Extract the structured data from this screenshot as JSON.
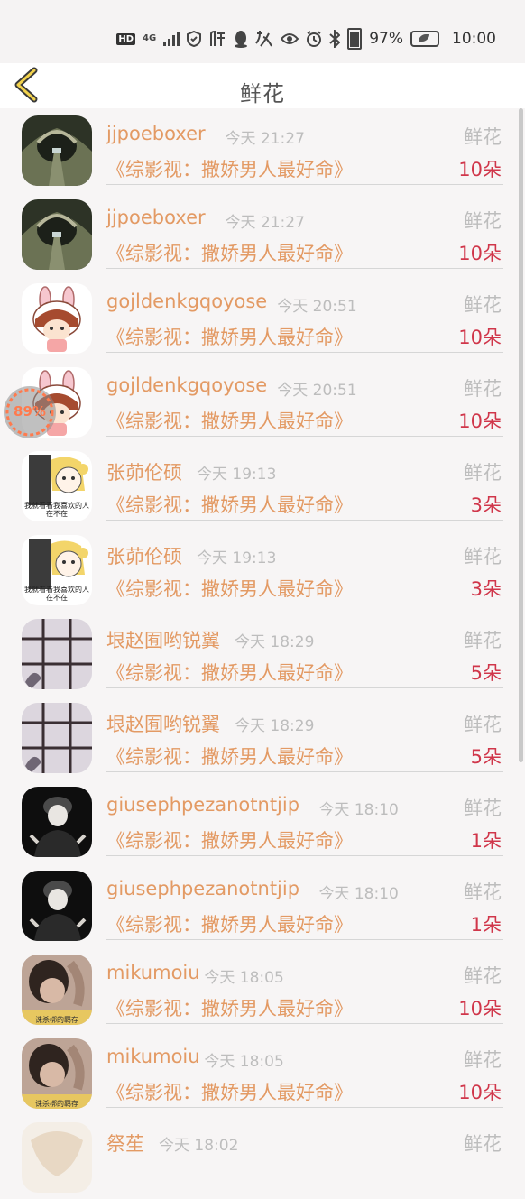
{
  "status_bar": {
    "network": "4G",
    "battery": "97%",
    "time": "10:00"
  },
  "header": {
    "title": "鲜花"
  },
  "float_widget": {
    "progress_text": "89%",
    "progress": 0.89
  },
  "items": [
    {
      "username": "jjpoeboxer",
      "time": "今天 21:27",
      "label": "鲜花",
      "book": "《综影视：撒娇男人最好命》",
      "count": "10朵",
      "avatar": "landscape"
    },
    {
      "username": "jjpoeboxer",
      "time": "今天 21:27",
      "label": "鲜花",
      "book": "《综影视：撒娇男人最好命》",
      "count": "10朵",
      "avatar": "landscape"
    },
    {
      "username": "gojldenkgqoyose",
      "time": "今天 20:51",
      "label": "鲜花",
      "book": "《综影视：撒娇男人最好命》",
      "count": "10朵",
      "avatar": "bunny"
    },
    {
      "username": "gojldenkgqoyose",
      "time": "今天 20:51",
      "label": "鲜花",
      "book": "《综影视：撒娇男人最好命》",
      "count": "10朵",
      "avatar": "bunny"
    },
    {
      "username": "张茆伦硕",
      "time": "今天 19:13",
      "label": "鲜花",
      "book": "《综影视：撒娇男人最好命》",
      "count": "3朵",
      "avatar": "cartoon-girl",
      "avatar_caption": "我就看看我喜欢的人在不在"
    },
    {
      "username": "张茆伦硕",
      "time": "今天 19:13",
      "label": "鲜花",
      "book": "《综影视：撒娇男人最好命》",
      "count": "3朵",
      "avatar": "cartoon-girl",
      "avatar_caption": "我就看看我喜欢的人在不在"
    },
    {
      "username": "垠赵囿哟锐翼",
      "time": "今天 18:29",
      "label": "鲜花",
      "book": "《综影视：撒娇男人最好命》",
      "count": "5朵",
      "avatar": "window"
    },
    {
      "username": "垠赵囿哟锐翼",
      "time": "今天 18:29",
      "label": "鲜花",
      "book": "《综影视：撒娇男人最好命》",
      "count": "5朵",
      "avatar": "window"
    },
    {
      "username": "giusephpezanotntjip",
      "time": "今天 18:10",
      "label": "鲜花",
      "book": "《综影视：撒娇男人最好命》",
      "count": "1朵",
      "avatar": "dark-person"
    },
    {
      "username": "giusephpezanotntjip",
      "time": "今天 18:10",
      "label": "鲜花",
      "book": "《综影视：撒娇男人最好命》",
      "count": "1朵",
      "avatar": "dark-person"
    },
    {
      "username": "mikumoiu",
      "time": "今天 18:05",
      "label": "鲜花",
      "book": "《综影视：撒娇男人最好命》",
      "count": "10朵",
      "avatar": "photo-caption",
      "avatar_caption": "诛杀梆的羁存"
    },
    {
      "username": "mikumoiu",
      "time": "今天 18:05",
      "label": "鲜花",
      "book": "《综影视：撒娇男人最好命》",
      "count": "10朵",
      "avatar": "photo-caption",
      "avatar_caption": "诛杀梆的羁存"
    },
    {
      "username": "祭苼",
      "time": "今天 18:02",
      "label": "鲜花",
      "book": "",
      "count": "",
      "avatar": "light-art"
    }
  ]
}
